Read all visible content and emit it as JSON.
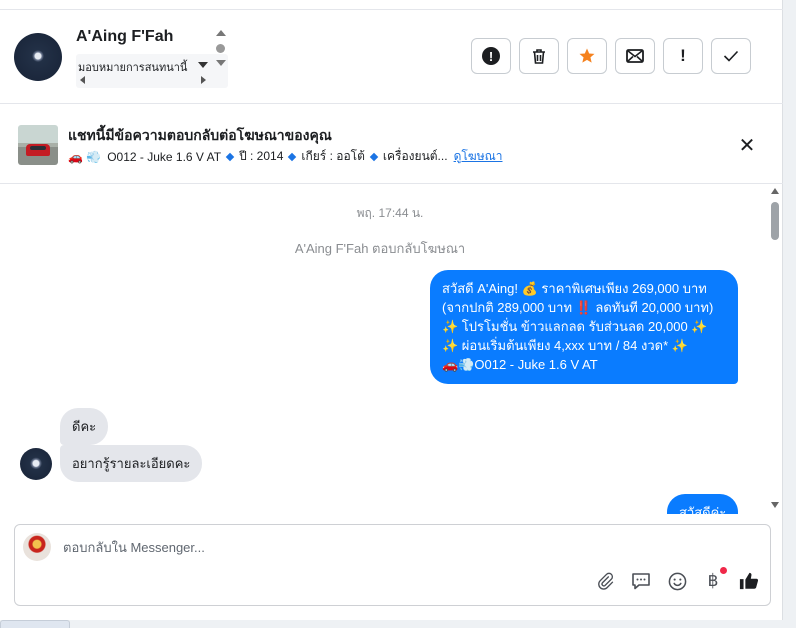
{
  "header": {
    "name": "A'Aing F'Fah",
    "assign_label": "มอบหมายการสนทนานี้",
    "actions": [
      {
        "name": "report-button",
        "icon": "alert-circle-icon",
        "label": "!"
      },
      {
        "name": "delete-button",
        "icon": "trash-icon",
        "label": "🗑"
      },
      {
        "name": "star-button",
        "icon": "star-icon",
        "label": "★"
      },
      {
        "name": "mark-unread-button",
        "icon": "envelope-icon",
        "label": "✉"
      },
      {
        "name": "follow-up-button",
        "icon": "exclamation-icon",
        "label": "!"
      },
      {
        "name": "done-button",
        "icon": "check-icon",
        "label": "✓"
      }
    ]
  },
  "ad": {
    "title": "แชทนี้มีข้อความตอบกลับต่อโฆษณาของคุณ",
    "emoji": "🚗 💨",
    "model": "O012 - Juke 1.6 V AT",
    "year": "ปี : 2014",
    "gear": "เกียร์ : ออโต้",
    "engine": "เครื่องยนต์...",
    "link": "ดูโฆษณา",
    "close": "✕"
  },
  "conversation": {
    "timestamp": "พฤ. 17:44 น.",
    "system_note": "A'Aing F'Fah ตอบกลับโฆษณา",
    "outgoing_1": "สวัสดี A'Aing! 💰 ราคาพิเศษเพียง 269,000 บาท\n(จากปกติ 289,000 บาท ‼️ ลดทันที 20,000 บาท)\n✨ โปรโมชั่น ข้าวแลกลด รับส่วนลด 20,000 ✨\n✨ ผ่อนเริ่มต้นเพียง 4,xxx บาท / 84 งวด* ✨\n🚗💨O012 - Juke 1.6 V AT",
    "incoming_1": "ดีคะ",
    "incoming_2": "อยากรู้รายละเอียดคะ",
    "outgoing_2": "สวัสดีค่ะ"
  },
  "composer": {
    "placeholder": "ตอบกลับใน Messenger...",
    "tools": [
      "paperclip-icon",
      "chat-bubble-icon",
      "smiley-icon",
      "baht-icon",
      "thumbs-up-icon"
    ]
  },
  "colors": {
    "accent": "#0a7cff",
    "star": "#f5821f",
    "link": "#1b74e4"
  }
}
